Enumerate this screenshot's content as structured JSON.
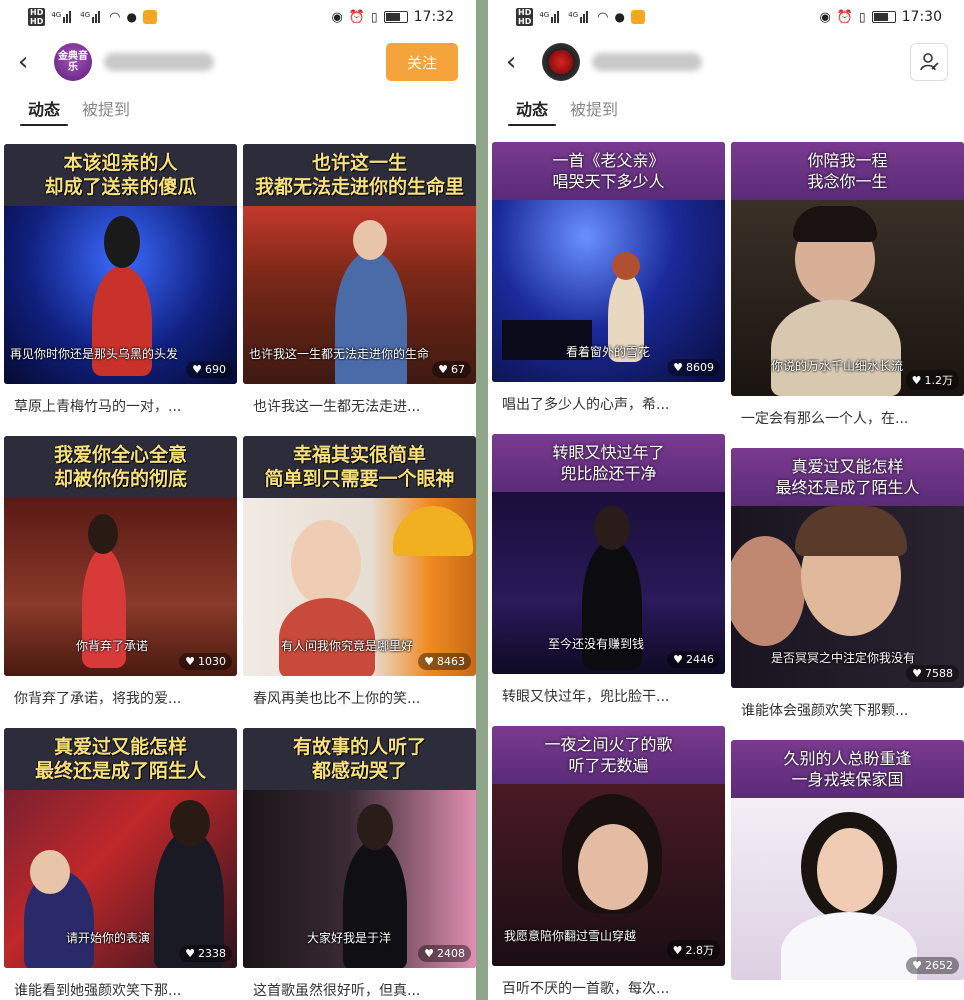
{
  "left": {
    "status": {
      "time": "17:32"
    },
    "header": {
      "avatar_text": "金典音乐",
      "follow_label": "关注"
    },
    "tabs": [
      "动态",
      "被提到"
    ],
    "cards": [
      {
        "title": [
          "本该迎亲的人",
          "却成了送亲的傻瓜"
        ],
        "subtitle": "再见你时你还是那头乌黑的头发",
        "likes": "690",
        "caption": "草原上青梅竹马的一对，..."
      },
      {
        "title": [
          "也许这一生",
          "我都无法走进你的生命里"
        ],
        "subtitle": "也许我这一生都无法走进你的生命",
        "likes": "67",
        "caption": "也许我这一生都无法走进..."
      },
      {
        "title": [
          "我爱你全心全意",
          "却被你伤的彻底"
        ],
        "subtitle": "你背弃了承诺",
        "likes": "1030",
        "caption": "你背弃了承诺，将我的爱..."
      },
      {
        "title": [
          "幸福其实很简单",
          "简单到只需要一个眼神"
        ],
        "subtitle": "有人问我你究竟是哪里好",
        "likes": "8463",
        "caption": "春风再美也比不上你的笑..."
      },
      {
        "title": [
          "真爱过又能怎样",
          "最终还是成了陌生人"
        ],
        "subtitle": "请开始你的表演",
        "likes": "2338",
        "caption": "谁能看到她强颜欢笑下那..."
      },
      {
        "title": [
          "有故事的人听了",
          "都感动哭了"
        ],
        "subtitle": "大家好我是于洋",
        "likes": "2408",
        "caption": "这首歌虽然很好听，但真..."
      }
    ]
  },
  "right": {
    "status": {
      "time": "17:30"
    },
    "header": {
      "avatar_text": ""
    },
    "tabs": [
      "动态",
      "被提到"
    ],
    "cards": [
      {
        "title": [
          "一首《老父亲》",
          "唱哭天下多少人"
        ],
        "subtitle": "看着窗外的雪花",
        "likes": "8609",
        "caption": "唱出了多少人的心声，希..."
      },
      {
        "title": [
          "你陪我一程",
          "我念你一生"
        ],
        "subtitle": "你说的万水千山细水长流",
        "likes": "1.2万",
        "caption": "一定会有那么一个人，在..."
      },
      {
        "title": [
          "转眼又快过年了",
          "兜比脸还干净"
        ],
        "subtitle": "至今还没有赚到钱",
        "likes": "2446",
        "caption": "转眼又快过年，兜比脸干..."
      },
      {
        "title": [
          "真爱过又能怎样",
          "最终还是成了陌生人"
        ],
        "subtitle": "是否冥冥之中注定你我没有",
        "likes": "7588",
        "caption": "谁能体会强颜欢笑下那颗..."
      },
      {
        "title": [
          "一夜之间火了的歌",
          "听了无数遍"
        ],
        "subtitle": "我愿意陪你翻过雪山穿越",
        "likes": "2.8万",
        "caption": "百听不厌的一首歌，每次..."
      },
      {
        "title": [
          "久别的人总盼重逢",
          "一身戎装保家国"
        ],
        "subtitle": "",
        "likes": "2652",
        "caption": ""
      }
    ]
  }
}
